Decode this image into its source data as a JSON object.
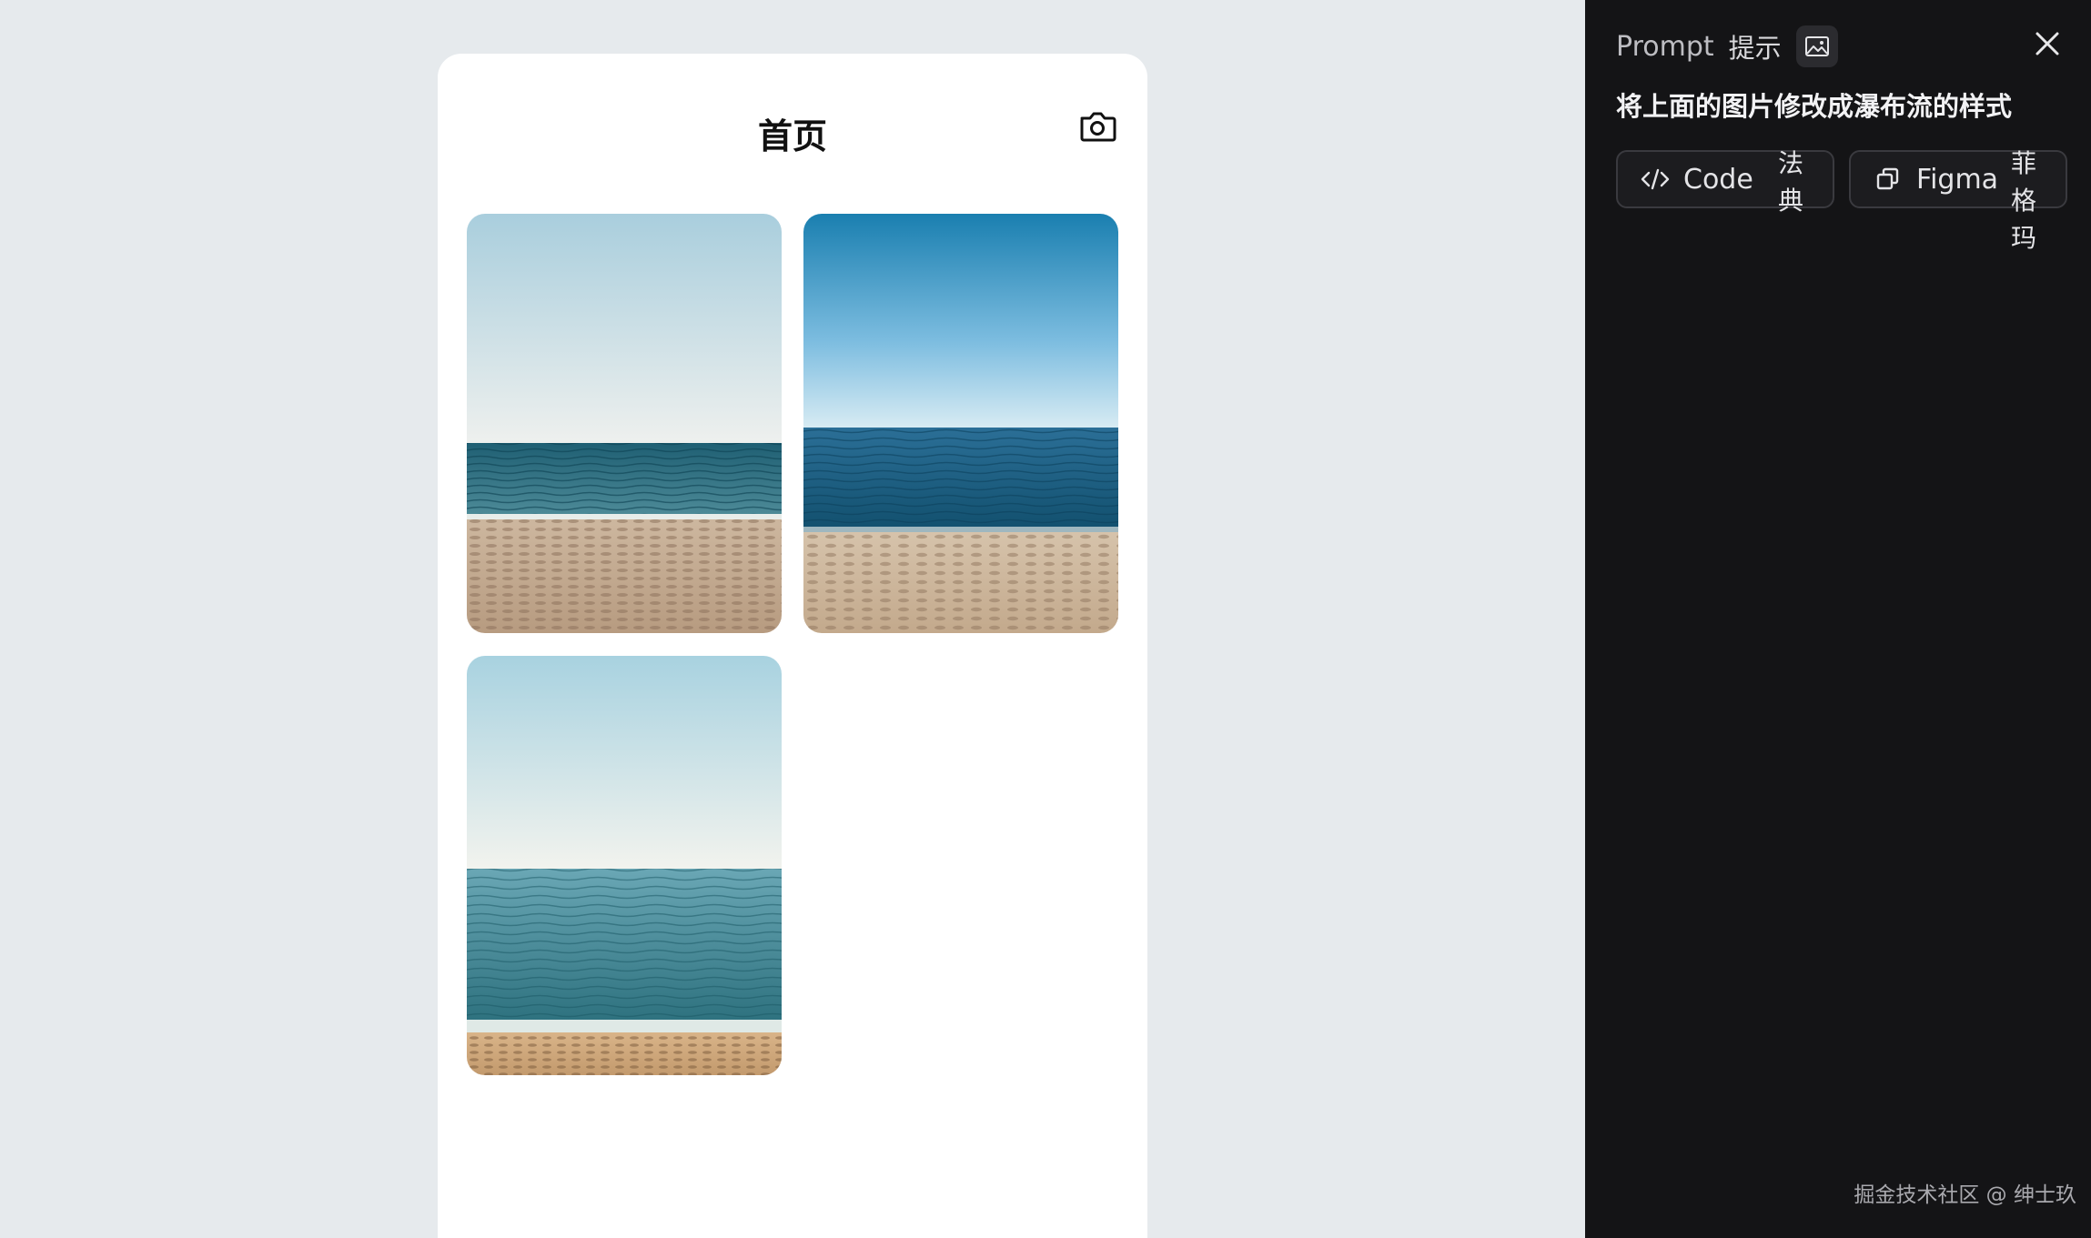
{
  "phone": {
    "title": "首页",
    "icons": {
      "camera": "camera-icon"
    },
    "images": [
      {
        "name": "beach-photo-1",
        "description_icon": "image"
      },
      {
        "name": "beach-photo-2",
        "description_icon": "image"
      },
      {
        "name": "beach-photo-3",
        "description_icon": "image"
      }
    ]
  },
  "sidebar": {
    "title": "Prompt",
    "subtitle": "提示",
    "prompt_text": "将上面的图片修改成瀑布流的样式",
    "buttons": {
      "code_label": "Code",
      "code_cjk": "法典",
      "figma_label": "Figma",
      "figma_cjk": "菲格玛"
    },
    "icons": {
      "image": "image-icon",
      "close": "close-icon",
      "code": "code-icon",
      "figma": "copy-icon"
    },
    "credit": "掘金技术社区 @ 绅士玖"
  },
  "colors": {
    "page_background": "#e6eaed",
    "sidebar_background": "#141416",
    "phone_background": "#ffffff"
  }
}
